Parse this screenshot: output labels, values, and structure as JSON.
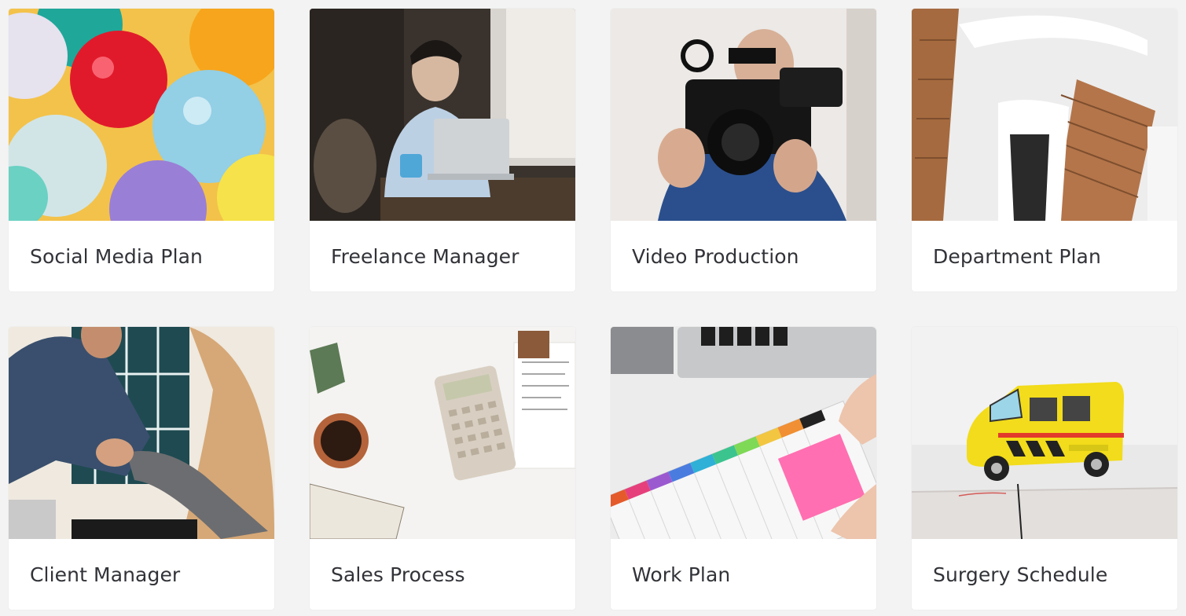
{
  "templates": [
    {
      "title": "Social Media Plan",
      "image": "balloons-photo"
    },
    {
      "title": "Freelance Manager",
      "image": "freelancer-laptop-photo"
    },
    {
      "title": "Video Production",
      "image": "video-camera-photo"
    },
    {
      "title": "Department Plan",
      "image": "staircase-photo"
    },
    {
      "title": "Client Manager",
      "image": "handshake-photo"
    },
    {
      "title": "Sales Process",
      "image": "calculator-desk-photo"
    },
    {
      "title": "Work Plan",
      "image": "planner-notebook-photo"
    },
    {
      "title": "Surgery Schedule",
      "image": "toy-ambulance-photo"
    }
  ]
}
